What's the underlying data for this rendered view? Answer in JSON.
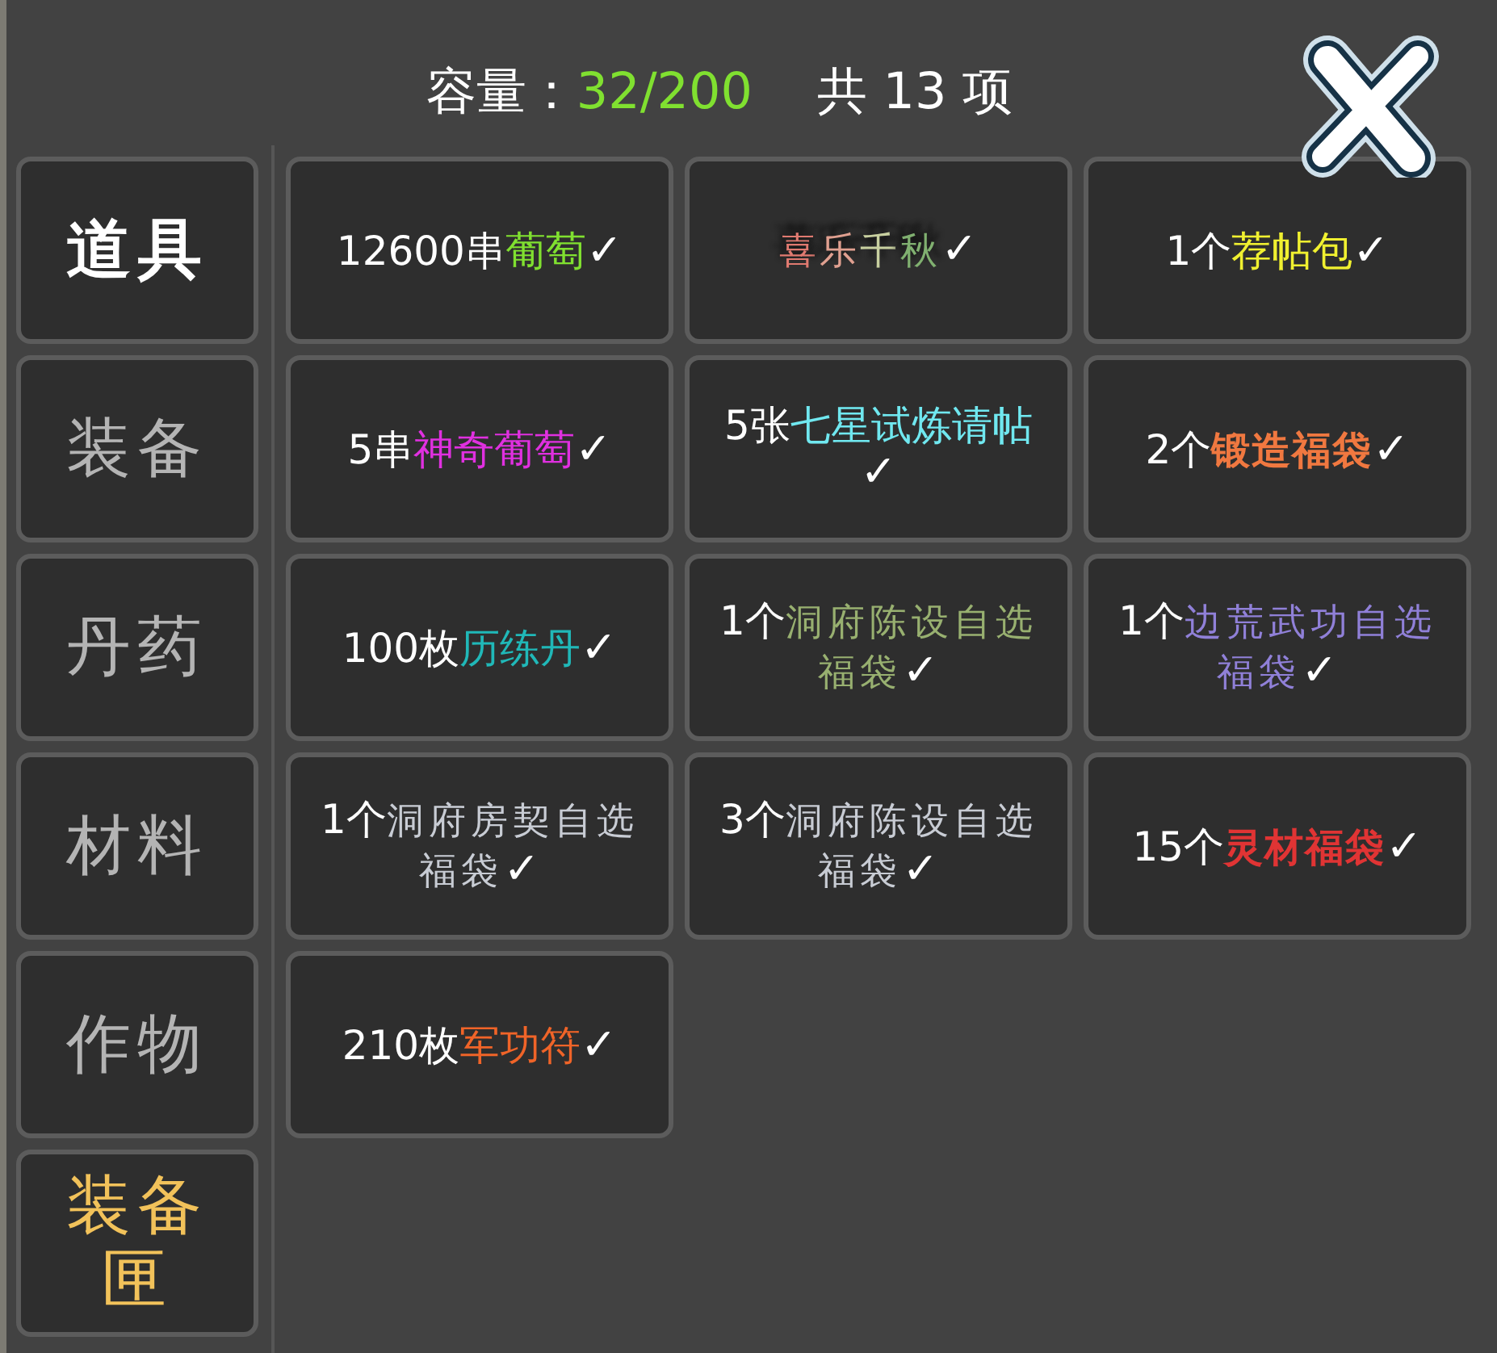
{
  "header": {
    "capacity_label": "容量：",
    "capacity_value": "32/200",
    "total": "共 13 项"
  },
  "sidebar": {
    "tabs": [
      {
        "label": "道具",
        "selected": true,
        "highlight": false
      },
      {
        "label": "装备",
        "selected": false,
        "highlight": false
      },
      {
        "label": "丹药",
        "selected": false,
        "highlight": false
      },
      {
        "label": "材料",
        "selected": false,
        "highlight": false
      },
      {
        "label": "作物",
        "selected": false,
        "highlight": false
      },
      {
        "label": "装备匣",
        "selected": false,
        "highlight": true
      }
    ]
  },
  "items": [
    {
      "kind": "plain",
      "count": "12600串",
      "name": "葡萄",
      "color": "#80e030",
      "check": "✓"
    },
    {
      "kind": "art",
      "parts": [
        {
          "text": "喜",
          "color": "#e07a70"
        },
        {
          "text": "乐",
          "color": "#e0a090"
        },
        {
          "text": "千",
          "color": "#c8d0a0"
        },
        {
          "text": "秋",
          "color": "#80b070"
        }
      ],
      "check": "✓"
    },
    {
      "kind": "plain",
      "count": "1个",
      "name": "荐帖包",
      "color": "#f0f030",
      "check": "✓"
    },
    {
      "kind": "plain",
      "count": "5串",
      "name": "神奇葡萄",
      "color": "#e030e0",
      "check": "✓"
    },
    {
      "kind": "plain",
      "count": "5张",
      "name": "七星试炼请帖",
      "color": "#70e8f0",
      "check": "✓"
    },
    {
      "kind": "heavy",
      "count": "2个",
      "name": "锻造福袋",
      "color": "#f07840",
      "check": "✓"
    },
    {
      "kind": "plain",
      "count": "100枚",
      "name": "历练丹",
      "color": "#20b8b8",
      "check": "✓"
    },
    {
      "kind": "brush",
      "count": "1个",
      "name": "洞府陈设自选福袋",
      "color": "#98b070",
      "check": "✓"
    },
    {
      "kind": "brush",
      "count": "1个",
      "name": "边荒武功自选福袋",
      "color": "#9080d8",
      "check": "✓"
    },
    {
      "kind": "brush",
      "count": "1个",
      "name": "洞府房契自选福袋",
      "color": "#c8ccd4",
      "check": "✓"
    },
    {
      "kind": "brush",
      "count": "3个",
      "name": "洞府陈设自选福袋",
      "color": "#c8ccd4",
      "check": "✓"
    },
    {
      "kind": "heavy",
      "count": "15个",
      "name": "灵材福袋",
      "color": "#e03434",
      "check": "✓"
    },
    {
      "kind": "plain",
      "count": "210枚",
      "name": "军功符",
      "color": "#f06428",
      "check": "✓"
    }
  ]
}
